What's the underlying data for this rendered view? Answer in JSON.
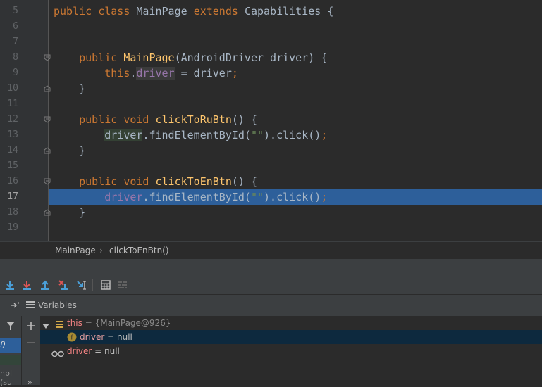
{
  "editor": {
    "lines": [
      {
        "num": "5",
        "tokens": [
          [
            "kw",
            "public class "
          ],
          [
            "",
            "MainPage "
          ],
          [
            "kw",
            "extends "
          ],
          [
            "",
            "Capabilities {"
          ]
        ]
      },
      {
        "num": "6",
        "tokens": []
      },
      {
        "num": "7",
        "tokens": []
      },
      {
        "num": "8",
        "tokens": [
          [
            "",
            "    "
          ],
          [
            "kw",
            "public "
          ],
          [
            "fn",
            "MainPage"
          ],
          [
            "",
            "(AndroidDriver driver) {"
          ]
        ]
      },
      {
        "num": "9",
        "tokens": [
          [
            "",
            "        "
          ],
          [
            "kw",
            "this"
          ],
          [
            "",
            "."
          ],
          [
            "fld inactive-fld",
            "driver"
          ],
          [
            "",
            " = driver"
          ],
          [
            "kw",
            ";"
          ]
        ]
      },
      {
        "num": "10",
        "tokens": [
          [
            "",
            "    }"
          ]
        ]
      },
      {
        "num": "11",
        "tokens": []
      },
      {
        "num": "12",
        "tokens": [
          [
            "",
            "    "
          ],
          [
            "kw",
            "public void "
          ],
          [
            "fn",
            "clickToRuBtn"
          ],
          [
            "",
            "() {"
          ]
        ]
      },
      {
        "num": "13",
        "tokens": [
          [
            "",
            "        "
          ],
          [
            "ghost",
            "driver"
          ],
          [
            "",
            ".findElementById("
          ],
          [
            "str",
            "\"\""
          ],
          [
            "",
            ").click()"
          ],
          [
            "kw",
            ";"
          ]
        ]
      },
      {
        "num": "14",
        "tokens": [
          [
            "",
            "    }"
          ]
        ]
      },
      {
        "num": "15",
        "tokens": []
      },
      {
        "num": "16",
        "tokens": [
          [
            "",
            "    "
          ],
          [
            "kw",
            "public void "
          ],
          [
            "fn",
            "clickToEnBtn"
          ],
          [
            "",
            "() {"
          ]
        ]
      },
      {
        "num": "17",
        "tokens": [
          [
            "",
            "        "
          ],
          [
            "fld",
            "driver"
          ],
          [
            "",
            ".findElementById("
          ],
          [
            "str",
            "\"\""
          ],
          [
            "",
            ").click()"
          ],
          [
            "kw",
            ";"
          ]
        ]
      },
      {
        "num": "18",
        "tokens": [
          [
            "",
            "    }"
          ]
        ]
      },
      {
        "num": "19",
        "tokens": []
      }
    ],
    "current_line": "17"
  },
  "breadcrumbs": {
    "class_name": "MainPage",
    "separator": "›",
    "method_name": "clickToEnBtn()"
  },
  "debugger": {
    "variables_title": "Variables",
    "left_frame_text": "f)",
    "left_frame_text2": "npl (su",
    "more_label": "»",
    "tree": [
      {
        "name": "this",
        "eq": " = ",
        "value": "{MainPage@926}",
        "expanded": true
      },
      {
        "name": "driver",
        "eq": " = ",
        "value": "null",
        "child": true
      },
      {
        "name": "driver",
        "eq": " = ",
        "value": "null",
        "watch": true
      }
    ]
  },
  "colors": {
    "accent_selection": "#2d5f9a",
    "keyword": "#cc7832",
    "method": "#ffc66d",
    "field": "#9876aa",
    "string": "#6a8759"
  }
}
